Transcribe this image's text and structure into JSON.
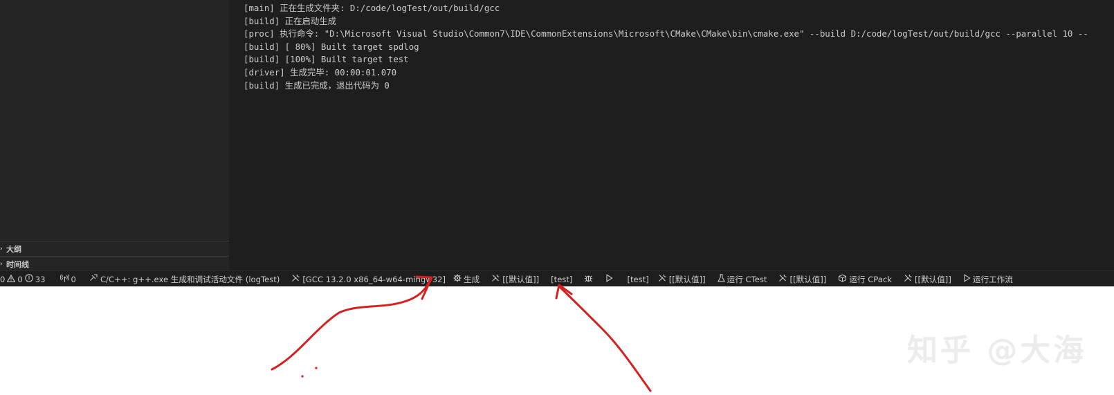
{
  "sidebar": {
    "sections": [
      {
        "label": "大纲",
        "icon": "chevron-right-icon"
      },
      {
        "label": "时间线",
        "icon": "chevron-right-icon"
      }
    ]
  },
  "output": {
    "lines": [
      "[main] 正在生成文件夹: D:/code/logTest/out/build/gcc",
      "[build] 正在启动生成",
      "[proc] 执行命令: \"D:\\Microsoft Visual Studio\\Common7\\IDE\\CommonExtensions\\Microsoft\\CMake\\CMake\\bin\\cmake.exe\" --build D:/code/logTest/out/build/gcc --parallel 10 --",
      "[build] [ 80%] Built target spdlog",
      "[build] [100%] Built target test",
      "[driver] 生成完毕: 00:00:01.070",
      "[build] 生成已完成，退出代码为 0"
    ]
  },
  "statusbar": {
    "errors": "0",
    "warnings": "0",
    "infos": "33",
    "ports": "0",
    "config": "C/C++: g++.exe 生成和调试活动文件 (logTest)",
    "kit": "[GCC 13.2.0 x86_64-w64-mingw32]",
    "build": "生成",
    "build_preset": "[[默认值]]",
    "target": "[test]",
    "launch_target": "[test]",
    "test_preset": "[[默认值]]",
    "ctest": "运行 CTest",
    "pack_preset": "[[默认值]]",
    "cpack": "运行 CPack",
    "workflow_preset": "[[默认值]]",
    "workflow": "运行工作流"
  },
  "watermark": "知乎 @大海",
  "colors": {
    "editor_bg": "#1e1e1e",
    "sidebar_bg": "#252526",
    "text": "#cccccc",
    "annotation": "#d42020"
  }
}
